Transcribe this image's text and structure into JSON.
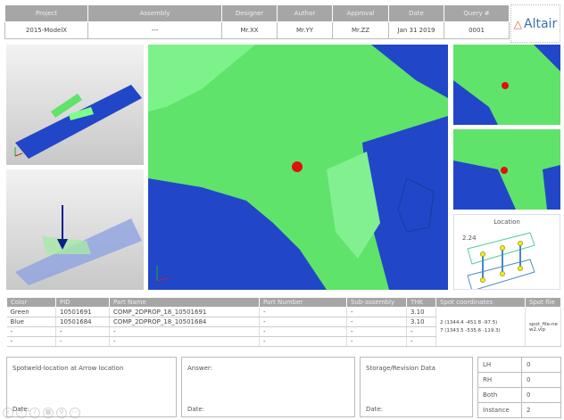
{
  "header": {
    "columns": [
      "Project",
      "Assembly",
      "Designer",
      "Author",
      "Approval",
      "Date",
      "Query #"
    ],
    "values": [
      "2015-ModelX",
      "---",
      "Mr.XX",
      "Mr.YY",
      "Mr.ZZ",
      "Jan 31 2019",
      "0001"
    ]
  },
  "logo": {
    "text": "Altair"
  },
  "location_panel": {
    "title": "Location",
    "dimension": "2.24"
  },
  "parts": {
    "columns": [
      "Color",
      "PID",
      "Part Name",
      "Part Number",
      "Sub-assembly",
      "THK",
      "Spot coordinates",
      "Spot file"
    ],
    "rows": [
      [
        "Green",
        "10501691",
        "COMP_2DPROP_18_10501691",
        "-",
        "-",
        "3.10"
      ],
      [
        "Blue",
        "10501684",
        "COMP_2DPROP_18_10501684",
        "-",
        "-",
        "3.10"
      ],
      [
        "-",
        "-",
        "-",
        "-",
        "-",
        "-"
      ],
      [
        "-",
        "-",
        "-",
        "-",
        "-",
        "-"
      ]
    ],
    "spot_coordinates": [
      "2 (1344.4 -451.8 -97.5)",
      "7 (1343.5 -535.6 -119.3)"
    ],
    "spot_file": "spot_file-new2.vip"
  },
  "notes": [
    {
      "title": "Spotweld-location at Arrow location",
      "date": "Date:"
    },
    {
      "title": "Answer:",
      "date": "Date:"
    },
    {
      "title": "Storage/Revision Data",
      "date": "Date:"
    }
  ],
  "counts": [
    {
      "label": "LH",
      "value": "0"
    },
    {
      "label": "RH",
      "value": "0"
    },
    {
      "label": "Both",
      "value": "0"
    },
    {
      "label": "Instance",
      "value": "2"
    }
  ],
  "colors": {
    "green": "#5fe36a",
    "blue": "#2147c8",
    "header_gray": "#a6a6a6",
    "spot_red": "#e01010"
  }
}
